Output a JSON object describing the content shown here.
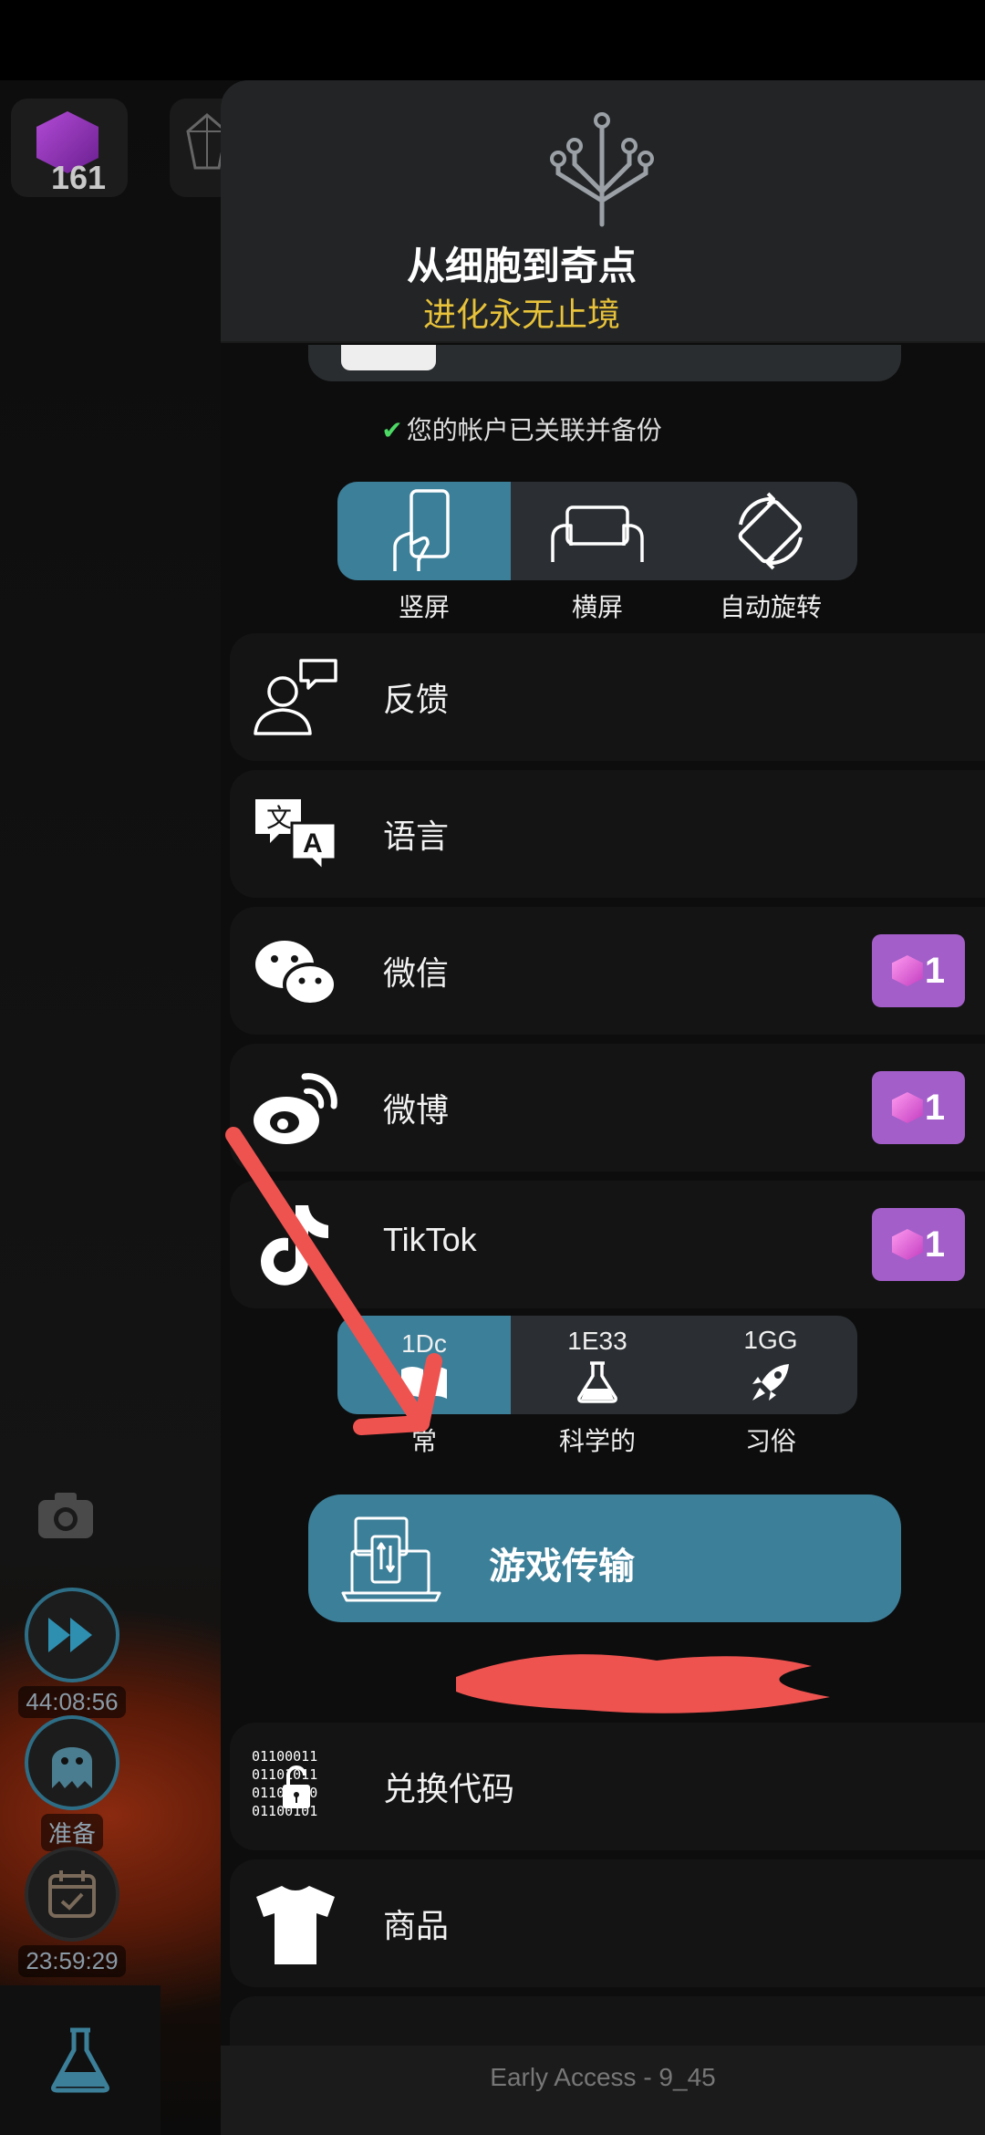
{
  "hud": {
    "cube_count": "161",
    "boost_timer": "44:08:56",
    "ghost_label": "准备",
    "daily_timer": "23:59:29"
  },
  "panel": {
    "title": "从细胞到奇点",
    "subtitle": "进化永无止境",
    "linked_note": "您的帐户已关联并备份",
    "orientation": {
      "options": [
        "竖屏",
        "横屏",
        "自动旋转"
      ],
      "selected": "竖屏"
    },
    "menu": [
      {
        "label": "反馈",
        "icon": "feedback-icon"
      },
      {
        "label": "语言",
        "icon": "language-icon"
      },
      {
        "label": "微信",
        "icon": "wechat-icon",
        "reward": "1"
      },
      {
        "label": "微博",
        "icon": "weibo-icon",
        "reward": "1"
      },
      {
        "label": "TikTok",
        "icon": "tiktok-icon",
        "reward": "1"
      }
    ],
    "notation": {
      "options": [
        {
          "value": "1Dc",
          "label": "常",
          "icon": "book-icon"
        },
        {
          "value": "1E33",
          "label": "科学的",
          "icon": "flask-icon"
        },
        {
          "value": "1GG",
          "label": "习俗",
          "icon": "rocket-icon"
        }
      ],
      "selected": "1Dc"
    },
    "transfer_button": "游戏传输",
    "menu_bottom": [
      {
        "label": "兑换代码",
        "icon": "redeem-code-icon"
      },
      {
        "label": "商品",
        "icon": "tshirt-icon"
      }
    ],
    "footer": "Early Access - 9_45"
  },
  "colors": {
    "accent": "#3c7f99",
    "reward": "#a35ec9",
    "subtitle": "#e7c23a",
    "annotation": "#ef5350"
  }
}
